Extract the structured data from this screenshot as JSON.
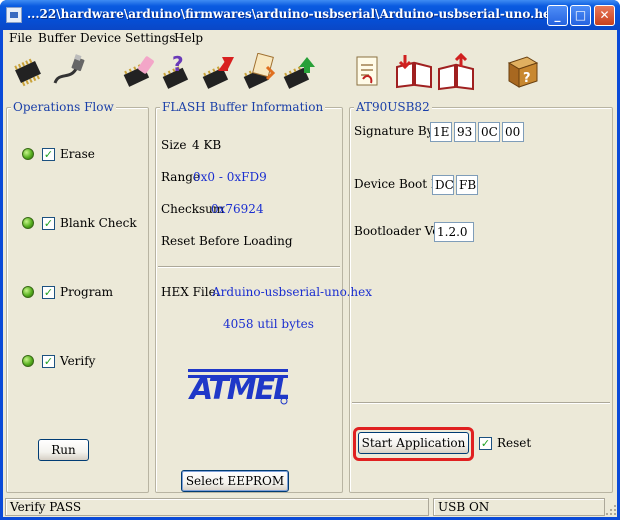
{
  "window": {
    "title": "...22\\hardware\\arduino\\firmwares\\arduino-usbserial\\Arduino-usbserial-uno.hex",
    "min_glyph": "_",
    "max_glyph": "□",
    "close_glyph": "✕"
  },
  "menu": [
    "File",
    "Buffer",
    "Device",
    "Settings",
    "Help"
  ],
  "toolbar": {
    "icons": [
      "chip-icon",
      "usb-cable-icon",
      "erase-chip-icon",
      "blank-check-icon",
      "program-chip-icon",
      "read-chip-icon",
      "verify-chip-icon",
      "load-hex-icon",
      "open-book-icon",
      "save-book-icon",
      "help-book-icon"
    ]
  },
  "operations": {
    "title": "Operations Flow",
    "steps": [
      {
        "label": "Erase",
        "checked": true
      },
      {
        "label": "Blank Check",
        "checked": true
      },
      {
        "label": "Program",
        "checked": true
      },
      {
        "label": "Verify",
        "checked": true
      }
    ],
    "check_glyph": "✓",
    "run_label": "Run"
  },
  "flash": {
    "title": "FLASH Buffer Information",
    "size_label": "Size",
    "size_value": "4 KB",
    "range_label": "Range",
    "range_value": "0x0 - 0xFD9",
    "checksum_label": "Checksum",
    "checksum_value": "0x76924",
    "reset_label": "Reset Before Loading",
    "hex_label": "HEX File:",
    "hex_value": "Arduino-usbserial-uno.hex",
    "bytes_value": "4058 util bytes",
    "logo_text": "ATMEL",
    "select_eeprom_label": "Select EEPROM"
  },
  "device": {
    "title": "AT90USB82",
    "signature_label": "Signature Bytes",
    "signature_bytes": [
      "1E",
      "93",
      "0C",
      "00"
    ],
    "boot_ids_label": "Device Boot Ids",
    "boot_ids": [
      "DC",
      "FB"
    ],
    "bootloader_label": "Bootloader Ver.",
    "bootloader_value": "1.2.0",
    "start_app_label": "Start Application",
    "reset_label": "Reset",
    "reset_checked": true
  },
  "status": {
    "left": "Verify PASS",
    "right": "USB ON"
  },
  "colors": {
    "titlebar": "#0550d8",
    "panel_bg": "#ece9d8",
    "group_title": "#1a3fa8",
    "value_text": "#1a2ed0",
    "highlight": "#e02020",
    "atmel_blue": "#1f38c8"
  }
}
